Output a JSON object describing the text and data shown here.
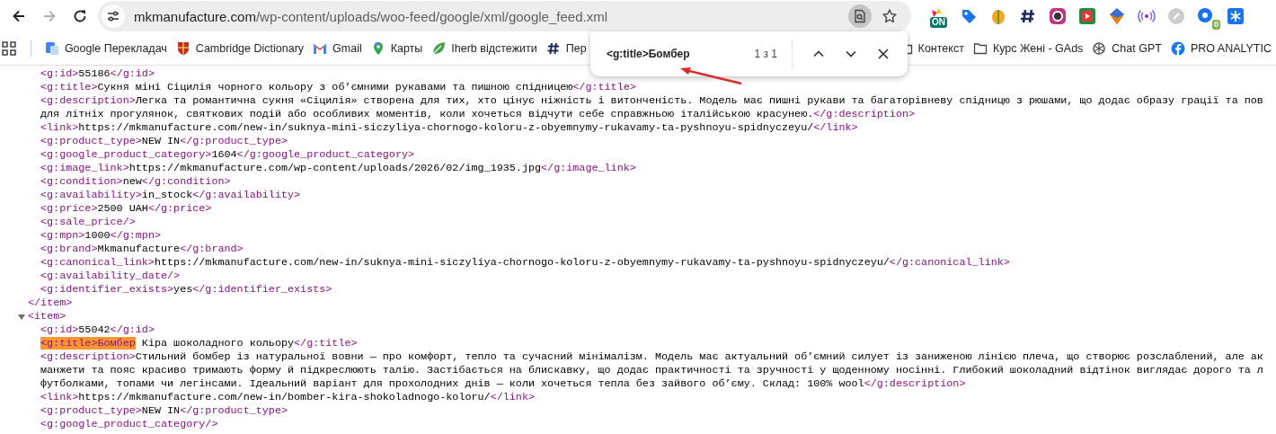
{
  "nav_buttons": [
    {
      "kind": "back",
      "disabled": false
    },
    {
      "kind": "forward",
      "disabled": true
    },
    {
      "kind": "reload",
      "disabled": false
    }
  ],
  "address_bar": {
    "host": "mkmanufacture.com",
    "path": "/wp-content/uploads/woo-feed/google/xml/google_feed.xml",
    "find_active": true
  },
  "extensions": [
    {
      "kind": "on",
      "badge": "ON"
    },
    {
      "kind": "tag"
    },
    {
      "kind": "fruit"
    },
    {
      "kind": "hash"
    },
    {
      "kind": "camera"
    },
    {
      "kind": "play"
    },
    {
      "kind": "shield"
    },
    {
      "kind": "broadcast"
    },
    {
      "kind": "link"
    },
    {
      "kind": "gear",
      "badge": "0"
    },
    {
      "kind": "snowflake"
    }
  ],
  "bookmarks_left": [
    {
      "kind": "translate",
      "label": "Google Перекладач"
    },
    {
      "kind": "crest",
      "label": "Cambridge Dictionary"
    },
    {
      "kind": "mail",
      "label": "Gmail"
    },
    {
      "kind": "pin",
      "label": "Карты"
    },
    {
      "kind": "leaf",
      "label": "Iherb відстежити"
    },
    {
      "kind": "hash",
      "label": "Пер"
    }
  ],
  "bookmarks_right": [
    {
      "kind": "folder",
      "label": "Контекст"
    },
    {
      "kind": "folder",
      "label": "Курс Жені - GAds"
    },
    {
      "kind": "knot",
      "label": "Chat GPT"
    },
    {
      "kind": "facebook",
      "label": "PRO ANALYTIC"
    }
  ],
  "find_bar": {
    "query": "<g:title>Бомбер",
    "count": "1 з 1"
  },
  "xml": [
    {
      "children": [
        {
          "parts": [
            {
              "kind": "tag",
              "text": "<g:id>"
            },
            {
              "kind": "text",
              "text": "55186"
            },
            {
              "kind": "tag",
              "text": "</g:id>"
            }
          ]
        },
        {
          "parts": [
            {
              "kind": "tag",
              "text": "<g:title>"
            },
            {
              "kind": "text",
              "text": "Сукня міні Сіцилія чорного кольору з об’ємними рукавами та пишною спідницею"
            },
            {
              "kind": "tag",
              "text": "</g:title>"
            }
          ]
        },
        {
          "parts": [
            {
              "kind": "tag",
              "text": "<g:description>"
            },
            {
              "kind": "text",
              "text": "Легка та романтична сукня «Сіцилія» створена для тих, хто цінує ніжність і витонченість. Модель має пишні рукави та багаторівневу спідницю з рюшами, що додає образу грації та пов"
            }
          ]
        },
        {
          "parts": [
            {
              "kind": "text",
              "text": "для літніх прогулянок, святкових подій або особливих моментів, коли хочеться відчути себе справжньою італійською красунею."
            },
            {
              "kind": "tag",
              "text": "</g:description>"
            }
          ]
        },
        {
          "parts": [
            {
              "kind": "tag",
              "text": "<link>"
            },
            {
              "kind": "text",
              "text": "https://mkmanufacture.com/new-in/suknya-mini-siczyliya-chornogo-koloru-z-obyemnymy-rukavamy-ta-pyshnoyu-spidnyczeyu/"
            },
            {
              "kind": "tag",
              "text": "</link>"
            }
          ]
        },
        {
          "parts": [
            {
              "kind": "tag",
              "text": "<g:product_type>"
            },
            {
              "kind": "text",
              "text": "NEW IN"
            },
            {
              "kind": "tag",
              "text": "</g:product_type>"
            }
          ]
        },
        {
          "parts": [
            {
              "kind": "tag",
              "text": "<g:google_product_category>"
            },
            {
              "kind": "text",
              "text": "1604"
            },
            {
              "kind": "tag",
              "text": "</g:google_product_category>"
            }
          ]
        },
        {
          "parts": [
            {
              "kind": "tag",
              "text": "<g:image_link>"
            },
            {
              "kind": "text",
              "text": "https://mkmanufacture.com/wp-content/uploads/2026/02/img_1935.jpg"
            },
            {
              "kind": "tag",
              "text": "</g:image_link>"
            }
          ]
        },
        {
          "parts": [
            {
              "kind": "tag",
              "text": "<g:condition>"
            },
            {
              "kind": "text",
              "text": "new"
            },
            {
              "kind": "tag",
              "text": "</g:condition>"
            }
          ]
        },
        {
          "parts": [
            {
              "kind": "tag",
              "text": "<g:availability>"
            },
            {
              "kind": "text",
              "text": "in_stock"
            },
            {
              "kind": "tag",
              "text": "</g:availability>"
            }
          ]
        },
        {
          "parts": [
            {
              "kind": "tag",
              "text": "<g:price>"
            },
            {
              "kind": "text",
              "text": "2500 UAH"
            },
            {
              "kind": "tag",
              "text": "</g:price>"
            }
          ]
        },
        {
          "parts": [
            {
              "kind": "tag",
              "text": "<g:sale_price/>"
            }
          ]
        },
        {
          "parts": [
            {
              "kind": "tag",
              "text": "<g:mpn>"
            },
            {
              "kind": "text",
              "text": "1000"
            },
            {
              "kind": "tag",
              "text": "</g:mpn>"
            }
          ]
        },
        {
          "parts": [
            {
              "kind": "tag",
              "text": "<g:brand>"
            },
            {
              "kind": "text",
              "text": "Mkmanufacture"
            },
            {
              "kind": "tag",
              "text": "</g:brand>"
            }
          ]
        },
        {
          "parts": [
            {
              "kind": "tag",
              "text": "<g:canonical_link>"
            },
            {
              "kind": "text",
              "text": "https://mkmanufacture.com/new-in/suknya-mini-siczyliya-chornogo-koloru-z-obyemnymy-rukavamy-ta-pyshnoyu-spidnyczeyu/"
            },
            {
              "kind": "tag",
              "text": "</g:canonical_link>"
            }
          ]
        },
        {
          "parts": [
            {
              "kind": "tag",
              "text": "<g:availability_date/>"
            }
          ]
        },
        {
          "parts": [
            {
              "kind": "tag",
              "text": "<g:identifier_exists>"
            },
            {
              "kind": "text",
              "text": "yes"
            },
            {
              "kind": "tag",
              "text": "</g:identifier_exists>"
            }
          ]
        }
      ],
      "close": "</item>"
    },
    {
      "expanded": true,
      "open": "<item>",
      "children": [
        {
          "parts": [
            {
              "kind": "tag",
              "text": "<g:id>"
            },
            {
              "kind": "text",
              "text": "55042"
            },
            {
              "kind": "tag",
              "text": "</g:id>"
            }
          ]
        },
        {
          "parts": [
            {
              "kind": "match",
              "text": "<g:title>Бомбер"
            },
            {
              "kind": "text",
              "text": " Кіра шоколадного кольору"
            },
            {
              "kind": "tag",
              "text": "</g:title>"
            }
          ]
        },
        {
          "parts": [
            {
              "kind": "tag",
              "text": "<g:description>"
            },
            {
              "kind": "text",
              "text": "Стильний бомбер із натуральної вовни — про комфорт, тепло та сучасний мінімалізм. Модель має актуальний об’ємний силует із заниженою лінією плеча, що створює розслаблений, але ак"
            }
          ]
        },
        {
          "parts": [
            {
              "kind": "text",
              "text": "манжети та пояс красиво тримають форму й підкреслюють талію. Застібається на блискавку, що додає практичності та зручності у щоденному носінні. Глибокий шоколадний відтінок виглядає дорого та л"
            }
          ]
        },
        {
          "parts": [
            {
              "kind": "text",
              "text": "футболками, топами чи легінсами. Ідеальний варіант для прохолодних днів — коли хочеться тепла без зайвого об’єму. Склад: 100% wool"
            },
            {
              "kind": "tag",
              "text": "</g:description>"
            }
          ]
        },
        {
          "parts": [
            {
              "kind": "tag",
              "text": "<link>"
            },
            {
              "kind": "text",
              "text": "https://mkmanufacture.com/new-in/bomber-kira-shokoladnogo-koloru/"
            },
            {
              "kind": "tag",
              "text": "</link>"
            }
          ]
        },
        {
          "parts": [
            {
              "kind": "tag",
              "text": "<g:product_type>"
            },
            {
              "kind": "text",
              "text": "NEW IN"
            },
            {
              "kind": "tag",
              "text": "</g:product_type>"
            }
          ]
        },
        {
          "parts": [
            {
              "kind": "tag",
              "text": "<g:google_product_category/>"
            }
          ]
        }
      ]
    }
  ]
}
